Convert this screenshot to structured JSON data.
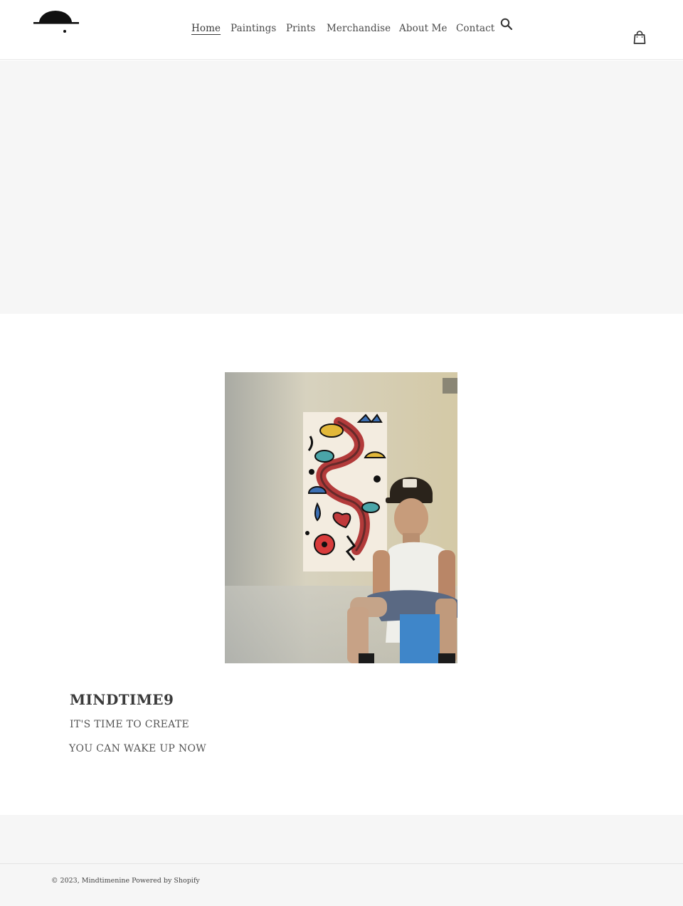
{
  "header": {
    "logo_icon": "half-sun-logo-icon",
    "nav": [
      {
        "label": "Home",
        "active": true
      },
      {
        "label": "Paintings",
        "active": false
      },
      {
        "label": "Prints",
        "active": false
      },
      {
        "label": "Merchandise",
        "active": false
      },
      {
        "label": "About Me",
        "active": false
      },
      {
        "label": "Contact",
        "active": false
      }
    ],
    "search_icon": "search-icon",
    "cart_icon": "cart-icon"
  },
  "featured": {
    "image_icon": "artist-with-painting-photo",
    "title": "MINDTIME9",
    "line1": "IT'S TIME TO CREATE",
    "line2": "YOU CAN WAKE UP NOW"
  },
  "footer": {
    "copyright": "© 2023,",
    "store_link": "Mindtimenine",
    "powered_by": "Powered by Shopify"
  },
  "colors": {
    "background": "#ffffff",
    "band": "#f6f6f6",
    "text": "#3a3a3a"
  }
}
